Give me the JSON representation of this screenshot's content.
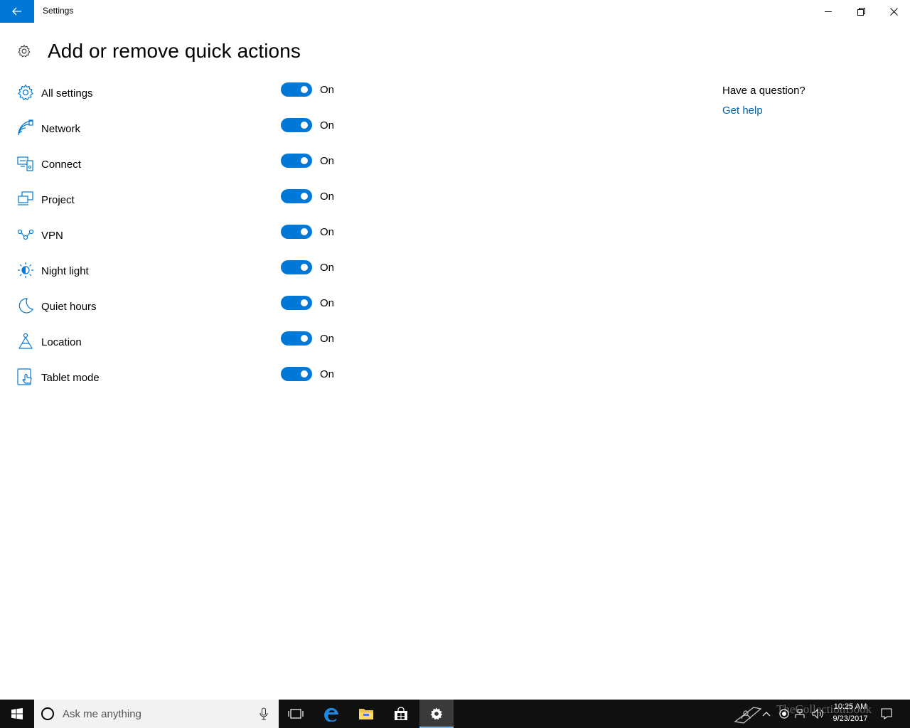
{
  "window": {
    "title": "Settings",
    "back_icon": "arrow-left-icon",
    "minimize_icon": "minimize-icon",
    "maximize_icon": "restore-icon",
    "close_icon": "close-icon"
  },
  "page": {
    "title": "Add or remove quick actions",
    "icon": "gear-icon"
  },
  "actions": [
    {
      "label": "All settings",
      "icon": "gear-icon",
      "state": "On"
    },
    {
      "label": "Network",
      "icon": "network-icon",
      "state": "On"
    },
    {
      "label": "Connect",
      "icon": "connect-icon",
      "state": "On"
    },
    {
      "label": "Project",
      "icon": "project-icon",
      "state": "On"
    },
    {
      "label": "VPN",
      "icon": "vpn-icon",
      "state": "On"
    },
    {
      "label": "Night light",
      "icon": "night-light-icon",
      "state": "On"
    },
    {
      "label": "Quiet hours",
      "icon": "moon-icon",
      "state": "On"
    },
    {
      "label": "Location",
      "icon": "location-icon",
      "state": "On"
    },
    {
      "label": "Tablet mode",
      "icon": "tablet-mode-icon",
      "state": "On"
    }
  ],
  "help": {
    "question": "Have a question?",
    "link": "Get help"
  },
  "taskbar": {
    "search_placeholder": "Ask me anything",
    "time": "10:25 AM",
    "date": "9/23/2017",
    "watermark": "TheCollectionBook"
  },
  "colors": {
    "accent": "#0078d7",
    "link": "#0063b1",
    "taskbar": "#101010"
  }
}
